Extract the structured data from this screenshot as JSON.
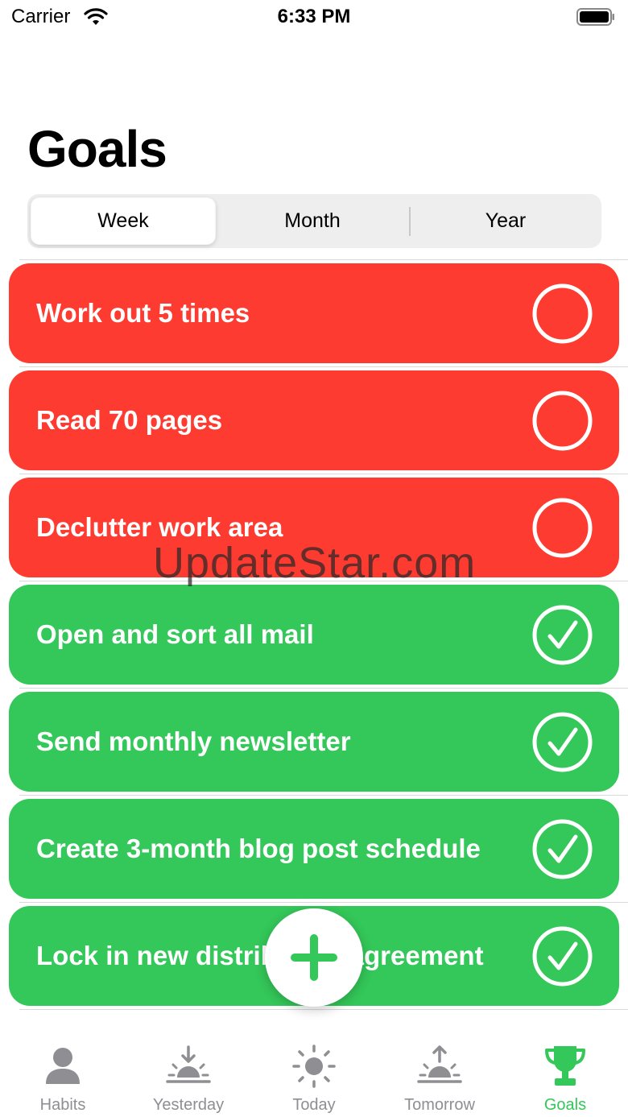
{
  "status_bar": {
    "carrier": "Carrier",
    "time": "6:33 PM"
  },
  "title": "Goals",
  "segments": [
    {
      "label": "Week",
      "selected": true
    },
    {
      "label": "Month",
      "selected": false
    },
    {
      "label": "Year",
      "selected": false
    }
  ],
  "goals": [
    {
      "label": "Work out 5 times",
      "completed": false,
      "color": "#fe3b30"
    },
    {
      "label": "Read 70 pages",
      "completed": false,
      "color": "#fe3b30"
    },
    {
      "label": "Declutter work area",
      "completed": false,
      "color": "#fe3b30"
    },
    {
      "label": "Open and sort all mail",
      "completed": true,
      "color": "#34c759"
    },
    {
      "label": "Send monthly newsletter",
      "completed": true,
      "color": "#34c759"
    },
    {
      "label": "Create 3-month blog post schedule",
      "completed": true,
      "color": "#34c759"
    },
    {
      "label": "Lock in new distribution agreement",
      "completed": true,
      "color": "#34c759"
    }
  ],
  "fab": {
    "icon": "plus-icon"
  },
  "watermark": "UpdateStar.com",
  "tabs": [
    {
      "label": "Habits",
      "icon": "person-icon",
      "active": false
    },
    {
      "label": "Yesterday",
      "icon": "sunset-icon",
      "active": false
    },
    {
      "label": "Today",
      "icon": "sun-icon",
      "active": false
    },
    {
      "label": "Tomorrow",
      "icon": "sunrise-icon",
      "active": false
    },
    {
      "label": "Goals",
      "icon": "trophy-icon",
      "active": true
    }
  ],
  "colors": {
    "accent": "#34c759",
    "incomplete": "#fe3b30",
    "inactive_tab": "#8e8e93"
  }
}
